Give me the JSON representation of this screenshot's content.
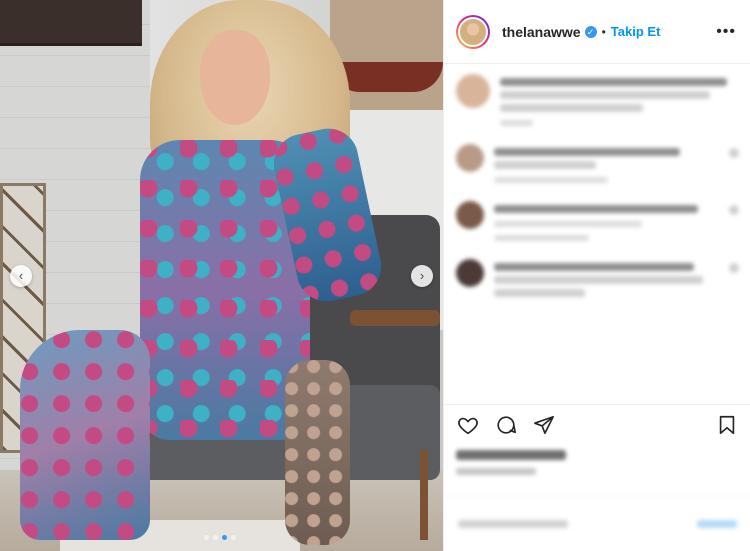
{
  "post": {
    "username": "thelanawwe",
    "verified_icon": "verified-badge-icon",
    "separator": "•",
    "follow_label": "Takip Et",
    "more_label": "•••"
  },
  "carousel": {
    "prev_label": "‹",
    "next_label": "›",
    "slide_count": 4,
    "active_slide": 3
  },
  "colors": {
    "accent": "#0095f6",
    "border": "#efefef",
    "text": "#262626"
  },
  "icons": [
    "heart-icon",
    "comment-icon",
    "share-icon",
    "bookmark-icon"
  ]
}
